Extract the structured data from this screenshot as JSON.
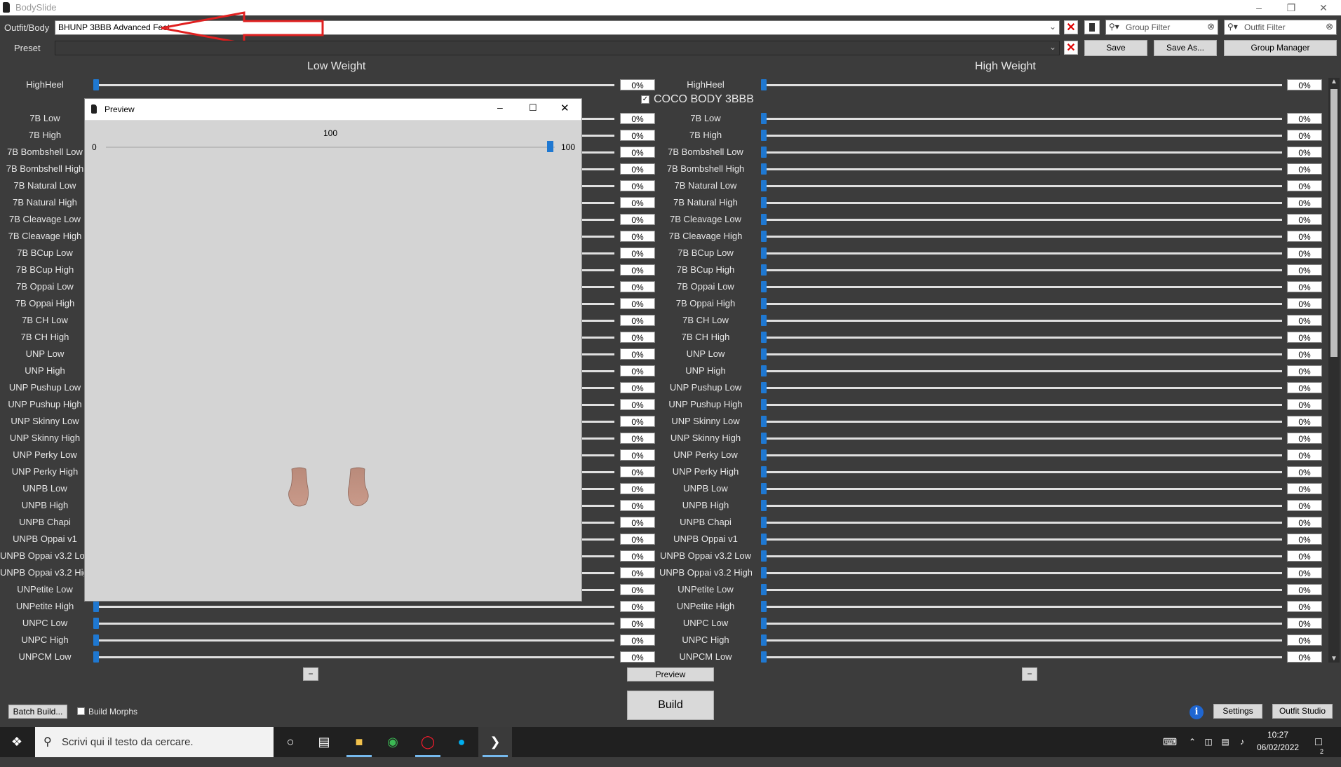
{
  "window": {
    "title": "BodySlide"
  },
  "toolbar": {
    "outfit_label": "Outfit/Body",
    "outfit_value": "BHUNP 3BBB Advanced Feet",
    "preset_label": "Preset",
    "preset_value": "",
    "group_filter_placeholder": "Group Filter",
    "outfit_filter_placeholder": "Outfit Filter",
    "save": "Save",
    "save_as": "Save As...",
    "group_manager": "Group Manager"
  },
  "headers": {
    "low": "Low Weight",
    "high": "High Weight"
  },
  "group_label": "COCO BODY 3BBB",
  "first_slider": {
    "name": "HighHeel",
    "low": "0%",
    "high": "0%"
  },
  "sliders": [
    {
      "name": "7B Low",
      "low": "0%",
      "high": "0%"
    },
    {
      "name": "7B High",
      "low": "0%",
      "high": "0%"
    },
    {
      "name": "7B Bombshell Low",
      "low": "0%",
      "high": "0%"
    },
    {
      "name": "7B Bombshell High",
      "low": "0%",
      "high": "0%"
    },
    {
      "name": "7B Natural Low",
      "low": "0%",
      "high": "0%"
    },
    {
      "name": "7B Natural High",
      "low": "0%",
      "high": "0%"
    },
    {
      "name": "7B Cleavage Low",
      "low": "0%",
      "high": "0%"
    },
    {
      "name": "7B Cleavage High",
      "low": "0%",
      "high": "0%"
    },
    {
      "name": "7B BCup Low",
      "low": "0%",
      "high": "0%"
    },
    {
      "name": "7B BCup High",
      "low": "0%",
      "high": "0%"
    },
    {
      "name": "7B Oppai Low",
      "low": "0%",
      "high": "0%"
    },
    {
      "name": "7B Oppai High",
      "low": "0%",
      "high": "0%"
    },
    {
      "name": "7B CH Low",
      "low": "0%",
      "high": "0%"
    },
    {
      "name": "7B CH High",
      "low": "0%",
      "high": "0%"
    },
    {
      "name": "UNP Low",
      "low": "0%",
      "high": "0%"
    },
    {
      "name": "UNP High",
      "low": "0%",
      "high": "0%"
    },
    {
      "name": "UNP Pushup Low",
      "low": "0%",
      "high": "0%"
    },
    {
      "name": "UNP Pushup High",
      "low": "0%",
      "high": "0%"
    },
    {
      "name": "UNP Skinny Low",
      "low": "0%",
      "high": "0%"
    },
    {
      "name": "UNP Skinny High",
      "low": "0%",
      "high": "0%"
    },
    {
      "name": "UNP Perky Low",
      "low": "0%",
      "high": "0%"
    },
    {
      "name": "UNP Perky High",
      "low": "0%",
      "high": "0%"
    },
    {
      "name": "UNPB Low",
      "low": "0%",
      "high": "0%"
    },
    {
      "name": "UNPB High",
      "low": "0%",
      "high": "0%"
    },
    {
      "name": "UNPB Chapi",
      "low": "0%",
      "high": "0%"
    },
    {
      "name": "UNPB Oppai v1",
      "low": "0%",
      "high": "0%"
    },
    {
      "name": "UNPB Oppai v3.2 Low",
      "low": "0%",
      "high": "0%"
    },
    {
      "name": "UNPB Oppai v3.2 High",
      "low": "0%",
      "high": "0%"
    },
    {
      "name": "UNPetite Low",
      "low": "0%",
      "high": "0%"
    },
    {
      "name": "UNPetite High",
      "low": "0%",
      "high": "0%"
    },
    {
      "name": "UNPC Low",
      "low": "0%",
      "high": "0%"
    },
    {
      "name": "UNPC High",
      "low": "0%",
      "high": "0%"
    },
    {
      "name": "UNPCM Low",
      "low": "0%",
      "high": "0%"
    }
  ],
  "preview_window": {
    "title": "Preview",
    "slider_value": "100",
    "slider_min": "0",
    "slider_max": "100"
  },
  "bottom": {
    "minus": "−",
    "preview": "Preview",
    "build": "Build",
    "batch_build": "Batch Build...",
    "build_morphs": "Build Morphs",
    "settings": "Settings",
    "outfit_studio": "Outfit Studio"
  },
  "taskbar": {
    "search_placeholder": "Scrivi qui il testo da cercare.",
    "time": "10:27",
    "date": "06/02/2022",
    "notifications": "2"
  },
  "colors": {
    "accent": "#1f78d1",
    "annotation": "#e02020"
  }
}
